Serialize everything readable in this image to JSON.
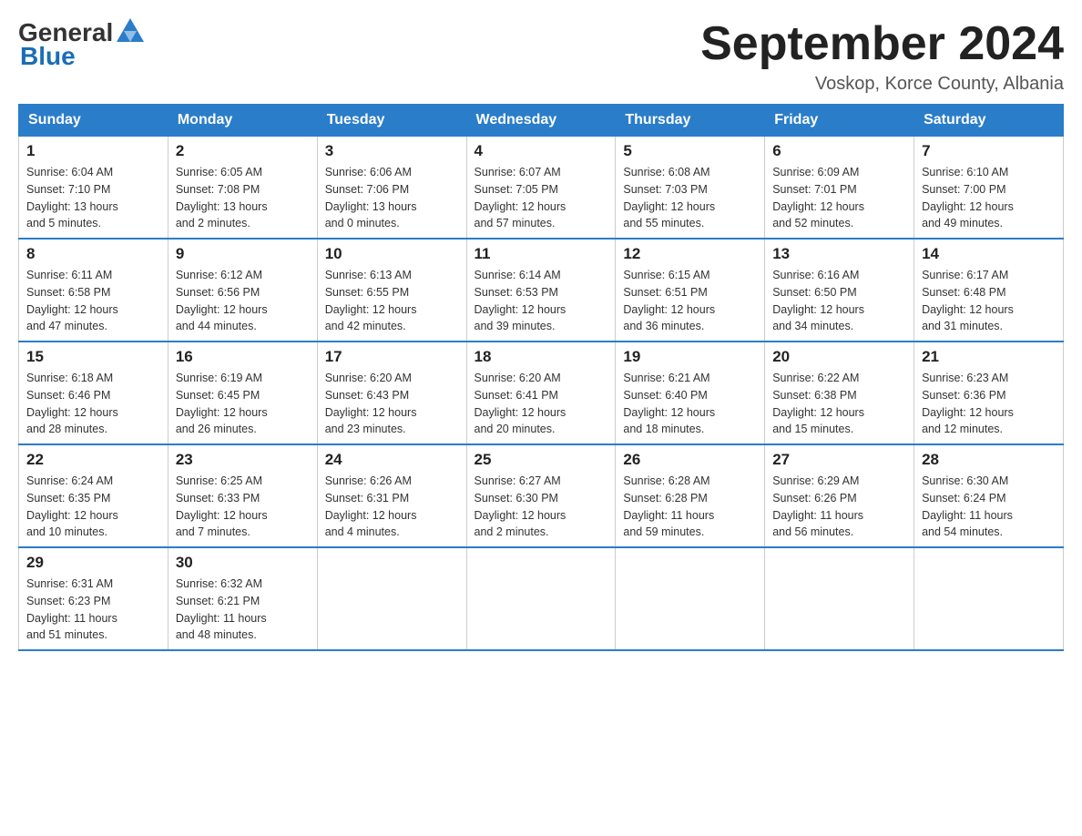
{
  "header": {
    "logo_general": "General",
    "logo_blue": "Blue",
    "month_title": "September 2024",
    "subtitle": "Voskop, Korce County, Albania"
  },
  "weekdays": [
    "Sunday",
    "Monday",
    "Tuesday",
    "Wednesday",
    "Thursday",
    "Friday",
    "Saturday"
  ],
  "weeks": [
    [
      {
        "day": "1",
        "sunrise": "6:04 AM",
        "sunset": "7:10 PM",
        "daylight": "13 hours and 5 minutes."
      },
      {
        "day": "2",
        "sunrise": "6:05 AM",
        "sunset": "7:08 PM",
        "daylight": "13 hours and 2 minutes."
      },
      {
        "day": "3",
        "sunrise": "6:06 AM",
        "sunset": "7:06 PM",
        "daylight": "13 hours and 0 minutes."
      },
      {
        "day": "4",
        "sunrise": "6:07 AM",
        "sunset": "7:05 PM",
        "daylight": "12 hours and 57 minutes."
      },
      {
        "day": "5",
        "sunrise": "6:08 AM",
        "sunset": "7:03 PM",
        "daylight": "12 hours and 55 minutes."
      },
      {
        "day": "6",
        "sunrise": "6:09 AM",
        "sunset": "7:01 PM",
        "daylight": "12 hours and 52 minutes."
      },
      {
        "day": "7",
        "sunrise": "6:10 AM",
        "sunset": "7:00 PM",
        "daylight": "12 hours and 49 minutes."
      }
    ],
    [
      {
        "day": "8",
        "sunrise": "6:11 AM",
        "sunset": "6:58 PM",
        "daylight": "12 hours and 47 minutes."
      },
      {
        "day": "9",
        "sunrise": "6:12 AM",
        "sunset": "6:56 PM",
        "daylight": "12 hours and 44 minutes."
      },
      {
        "day": "10",
        "sunrise": "6:13 AM",
        "sunset": "6:55 PM",
        "daylight": "12 hours and 42 minutes."
      },
      {
        "day": "11",
        "sunrise": "6:14 AM",
        "sunset": "6:53 PM",
        "daylight": "12 hours and 39 minutes."
      },
      {
        "day": "12",
        "sunrise": "6:15 AM",
        "sunset": "6:51 PM",
        "daylight": "12 hours and 36 minutes."
      },
      {
        "day": "13",
        "sunrise": "6:16 AM",
        "sunset": "6:50 PM",
        "daylight": "12 hours and 34 minutes."
      },
      {
        "day": "14",
        "sunrise": "6:17 AM",
        "sunset": "6:48 PM",
        "daylight": "12 hours and 31 minutes."
      }
    ],
    [
      {
        "day": "15",
        "sunrise": "6:18 AM",
        "sunset": "6:46 PM",
        "daylight": "12 hours and 28 minutes."
      },
      {
        "day": "16",
        "sunrise": "6:19 AM",
        "sunset": "6:45 PM",
        "daylight": "12 hours and 26 minutes."
      },
      {
        "day": "17",
        "sunrise": "6:20 AM",
        "sunset": "6:43 PM",
        "daylight": "12 hours and 23 minutes."
      },
      {
        "day": "18",
        "sunrise": "6:20 AM",
        "sunset": "6:41 PM",
        "daylight": "12 hours and 20 minutes."
      },
      {
        "day": "19",
        "sunrise": "6:21 AM",
        "sunset": "6:40 PM",
        "daylight": "12 hours and 18 minutes."
      },
      {
        "day": "20",
        "sunrise": "6:22 AM",
        "sunset": "6:38 PM",
        "daylight": "12 hours and 15 minutes."
      },
      {
        "day": "21",
        "sunrise": "6:23 AM",
        "sunset": "6:36 PM",
        "daylight": "12 hours and 12 minutes."
      }
    ],
    [
      {
        "day": "22",
        "sunrise": "6:24 AM",
        "sunset": "6:35 PM",
        "daylight": "12 hours and 10 minutes."
      },
      {
        "day": "23",
        "sunrise": "6:25 AM",
        "sunset": "6:33 PM",
        "daylight": "12 hours and 7 minutes."
      },
      {
        "day": "24",
        "sunrise": "6:26 AM",
        "sunset": "6:31 PM",
        "daylight": "12 hours and 4 minutes."
      },
      {
        "day": "25",
        "sunrise": "6:27 AM",
        "sunset": "6:30 PM",
        "daylight": "12 hours and 2 minutes."
      },
      {
        "day": "26",
        "sunrise": "6:28 AM",
        "sunset": "6:28 PM",
        "daylight": "11 hours and 59 minutes."
      },
      {
        "day": "27",
        "sunrise": "6:29 AM",
        "sunset": "6:26 PM",
        "daylight": "11 hours and 56 minutes."
      },
      {
        "day": "28",
        "sunrise": "6:30 AM",
        "sunset": "6:24 PM",
        "daylight": "11 hours and 54 minutes."
      }
    ],
    [
      {
        "day": "29",
        "sunrise": "6:31 AM",
        "sunset": "6:23 PM",
        "daylight": "11 hours and 51 minutes."
      },
      {
        "day": "30",
        "sunrise": "6:32 AM",
        "sunset": "6:21 PM",
        "daylight": "11 hours and 48 minutes."
      },
      null,
      null,
      null,
      null,
      null
    ]
  ],
  "labels": {
    "sunrise": "Sunrise:",
    "sunset": "Sunset:",
    "daylight": "Daylight:"
  }
}
